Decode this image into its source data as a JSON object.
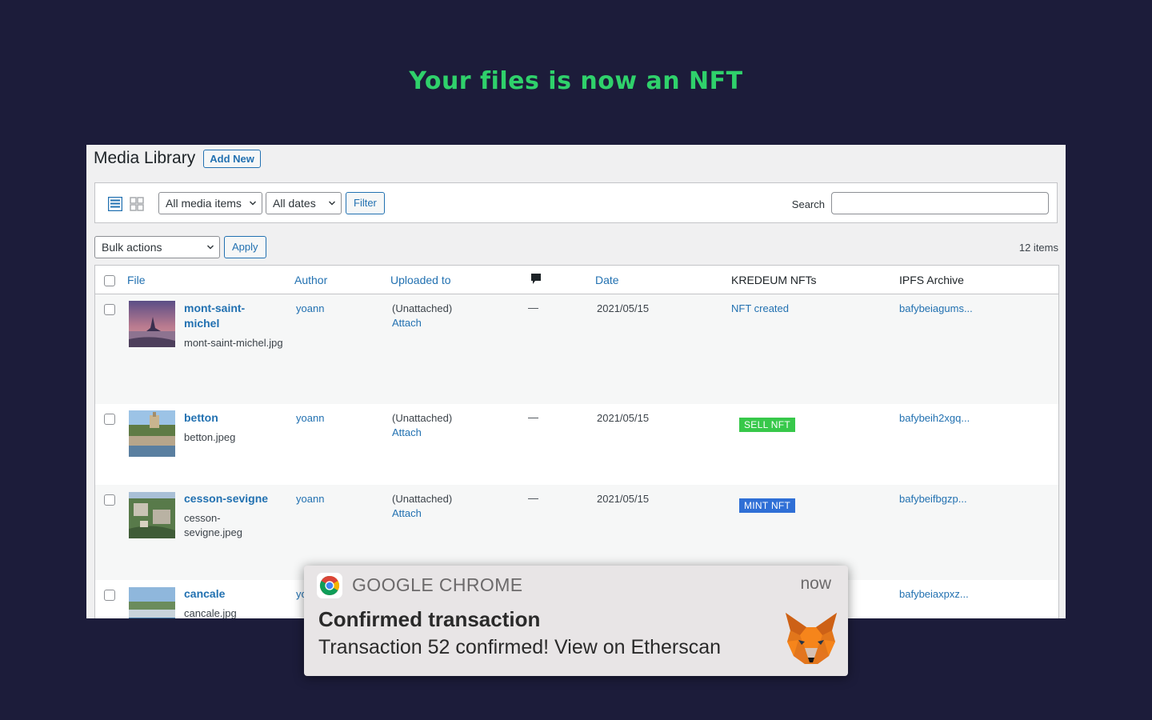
{
  "headline": "Your files is now an NFT",
  "media": {
    "title": "Media Library",
    "add_new": "Add New",
    "filter_type": "All media items",
    "filter_date": "All dates",
    "filter_button": "Filter",
    "search_label": "Search",
    "bulk_actions": "Bulk actions",
    "apply": "Apply",
    "items_count": "12 items",
    "columns": {
      "file": "File",
      "author": "Author",
      "uploaded_to": "Uploaded to",
      "date": "Date",
      "kredeum": "KREDEUM NFTs",
      "ipfs": "IPFS Archive"
    },
    "rows": [
      {
        "title_line1": "mont-saint-",
        "title_line2": "michel",
        "filename": "mont-saint-michel.jpg",
        "author": "yoann",
        "uploaded": "(Unattached)",
        "attach": "Attach",
        "comments": "—",
        "date": "2021/05/15",
        "kredeum": "NFT created",
        "ipfs": "bafybeiagums..."
      },
      {
        "title": "betton",
        "filename": "betton.jpeg",
        "author": "yoann",
        "uploaded": "(Unattached)",
        "attach": "Attach",
        "comments": "—",
        "date": "2021/05/15",
        "kredeum": "SELL NFT",
        "ipfs": "bafybeih2xgq..."
      },
      {
        "title": "cesson-sevigne",
        "filename_line1": "cesson-",
        "filename_line2": "sevigne.jpeg",
        "author": "yoann",
        "uploaded": "(Unattached)",
        "attach": "Attach",
        "comments": "—",
        "date": "2021/05/15",
        "kredeum": "MINT NFT",
        "ipfs": "bafybeifbgzp..."
      },
      {
        "title": "cancale",
        "filename": "cancale.jpg",
        "author": "yo",
        "ipfs": "bafybeiaxpxz..."
      }
    ]
  },
  "notification": {
    "app": "GOOGLE CHROME",
    "time": "now",
    "title": "Confirmed transaction",
    "body": "Transaction 52 confirmed! View on Etherscan",
    "app_icon": "chrome-icon",
    "image_icon": "metamask-fox-icon"
  },
  "colors": {
    "background": "#1c1c3a",
    "headline": "#2fd16b",
    "link": "#2271b1",
    "sell_badge": "#37c84a",
    "mint_badge": "#2f6fd6"
  }
}
